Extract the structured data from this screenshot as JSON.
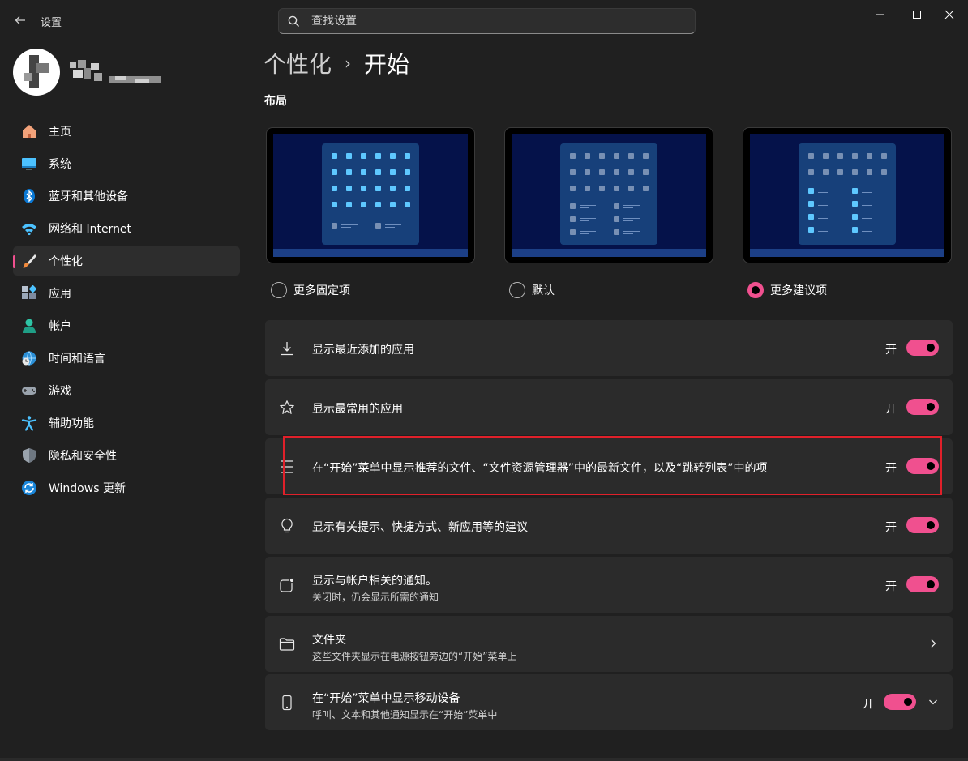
{
  "window": {
    "title": "设置",
    "search_placeholder": "查找设置"
  },
  "sidebar": {
    "items": [
      {
        "label": "主页",
        "icon": "home-icon"
      },
      {
        "label": "系统",
        "icon": "monitor-icon"
      },
      {
        "label": "蓝牙和其他设备",
        "icon": "bluetooth-icon"
      },
      {
        "label": "网络和 Internet",
        "icon": "wifi-icon"
      },
      {
        "label": "个性化",
        "icon": "brush-icon",
        "active": true
      },
      {
        "label": "应用",
        "icon": "apps-icon"
      },
      {
        "label": "帐户",
        "icon": "person-icon"
      },
      {
        "label": "时间和语言",
        "icon": "globe-clock-icon"
      },
      {
        "label": "游戏",
        "icon": "gamepad-icon"
      },
      {
        "label": "辅助功能",
        "icon": "accessibility-icon"
      },
      {
        "label": "隐私和安全性",
        "icon": "shield-icon"
      },
      {
        "label": "Windows 更新",
        "icon": "update-icon"
      }
    ]
  },
  "breadcrumb": {
    "parent": "个性化",
    "separator": "›",
    "current": "开始"
  },
  "layout": {
    "section_title": "布局",
    "options": [
      {
        "label": "更多固定项",
        "checked": false
      },
      {
        "label": "默认",
        "checked": false
      },
      {
        "label": "更多建议项",
        "checked": true
      }
    ]
  },
  "settings": [
    {
      "title": "显示最近添加的应用",
      "subtitle": "",
      "state": "开",
      "icon": "download-icon",
      "control": "toggle",
      "on": true
    },
    {
      "title": "显示最常用的应用",
      "subtitle": "",
      "state": "开",
      "icon": "star-icon",
      "control": "toggle",
      "on": true
    },
    {
      "title": "在“开始”菜单中显示推荐的文件、“文件资源管理器”中的最新文件，以及“跳转列表”中的项",
      "subtitle": "",
      "state": "开",
      "icon": "list-icon",
      "control": "toggle",
      "on": true
    },
    {
      "title": "显示有关提示、快捷方式、新应用等的建议",
      "subtitle": "",
      "state": "开",
      "icon": "lightbulb-icon",
      "control": "toggle",
      "on": true
    },
    {
      "title": "显示与帐户相关的通知。",
      "subtitle": "关闭时，仍会显示所需的通知",
      "state": "开",
      "icon": "notification-icon",
      "control": "toggle",
      "on": true
    },
    {
      "title": "文件夹",
      "subtitle": "这些文件夹显示在电源按钮旁边的“开始”菜单上",
      "state": "",
      "icon": "folder-icon",
      "control": "chevron-right"
    },
    {
      "title": "在“开始”菜单中显示移动设备",
      "subtitle": "呼叫、文本和其他通知显示在“开始”菜单中",
      "state": "开",
      "icon": "phone-icon",
      "control": "toggle-expand",
      "on": true
    }
  ],
  "colors": {
    "accent": "#f0508f",
    "background": "#202020",
    "card": "#2b2b2b",
    "highlight": "#e0202a"
  }
}
